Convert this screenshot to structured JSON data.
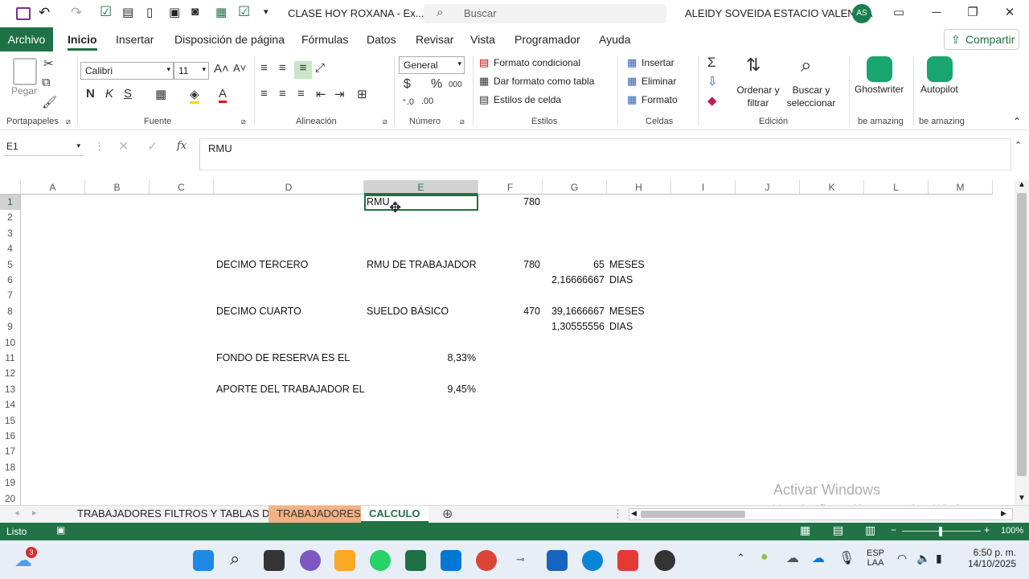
{
  "window": {
    "title": "CLASE HOY ROXANA  -  Ex...",
    "search_placeholder": "Buscar",
    "user_name": "ALEIDY SOVEIDA ESTACIO VALENCIA",
    "user_initials": "AS"
  },
  "tabs": [
    "Archivo",
    "Inicio",
    "Insertar",
    "Disposición de página",
    "Fórmulas",
    "Datos",
    "Revisar",
    "Vista",
    "Programador",
    "Ayuda"
  ],
  "share_label": "Compartir",
  "ribbon": {
    "clipboard": {
      "paste_label": "Pegar",
      "group_label": "Portapapeles"
    },
    "font": {
      "font_name": "Calibri",
      "font_size": "11",
      "bold": "N",
      "italic": "K",
      "underline": "S",
      "group_label": "Fuente"
    },
    "alignment": {
      "group_label": "Alineación"
    },
    "number": {
      "format": "General",
      "currency": "$",
      "percent": "%",
      "thousands": "000",
      "group_label": "Número"
    },
    "styles": {
      "conditional": "Formato condicional",
      "as_table": "Dar formato como tabla",
      "cell_styles": "Estilos de celda",
      "group_label": "Estilos"
    },
    "cells": {
      "insert": "Insertar",
      "delete": "Eliminar",
      "format": "Formato",
      "group_label": "Celdas"
    },
    "editing": {
      "sort_filter": "Ordenar y filtrar",
      "find_select": "Buscar y seleccionar",
      "group_label": "Edición"
    },
    "addins": [
      {
        "label": "Ghostwriter",
        "group_label": "be amazing"
      },
      {
        "label": "Autopilot",
        "group_label": "be amazing"
      }
    ]
  },
  "formula_bar": {
    "name_box": "E1",
    "fx": "fx",
    "content": "RMU"
  },
  "columns": [
    "A",
    "B",
    "C",
    "D",
    "E",
    "F",
    "G",
    "H",
    "I",
    "J",
    "K",
    "L",
    "M"
  ],
  "rows": [
    "1",
    "2",
    "3",
    "4",
    "5",
    "6",
    "7",
    "8",
    "9",
    "10",
    "11",
    "12",
    "13",
    "14",
    "15",
    "16",
    "17",
    "18",
    "19",
    "20"
  ],
  "cells": {
    "E1": "RMU",
    "F1": "780",
    "D5": "DECIMO TERCERO",
    "E5": "RMU DE TRABAJADOR",
    "F5": "780",
    "G5": "65",
    "H5": "MESES",
    "G6": "2,16666667",
    "H6": "DIAS",
    "D8": "DECIMO CUARTO",
    "E8": "SUELDO BÁSICO",
    "F8": "470",
    "G8": "39,1666667",
    "H8": "MESES",
    "G9": "1,30555556",
    "H9": "DIAS",
    "D11": "FONDO DE RESERVA ES EL",
    "E11": "8,33%",
    "D13": "APORTE DEL TRABAJADOR EL",
    "E13": "9,45%"
  },
  "sheets": [
    "TRABAJADORES FILTROS Y TABLAS D",
    "TRABAJADORES",
    "CALCULO"
  ],
  "status": {
    "ready": "Listo",
    "zoom": "100%"
  },
  "watermark": {
    "line1": "Activar Windows",
    "line2": "Ve a Configuración para activar Windows."
  },
  "taskbar": {
    "notification_badge": "3",
    "language": "ESP",
    "language_sub": "LAA",
    "time": "6:50 p. m.",
    "date": "14/10/2025"
  },
  "colors": {
    "excel_green": "#1e7145",
    "status_green": "#217346",
    "sheet_trab_tab": "#f4b183"
  }
}
